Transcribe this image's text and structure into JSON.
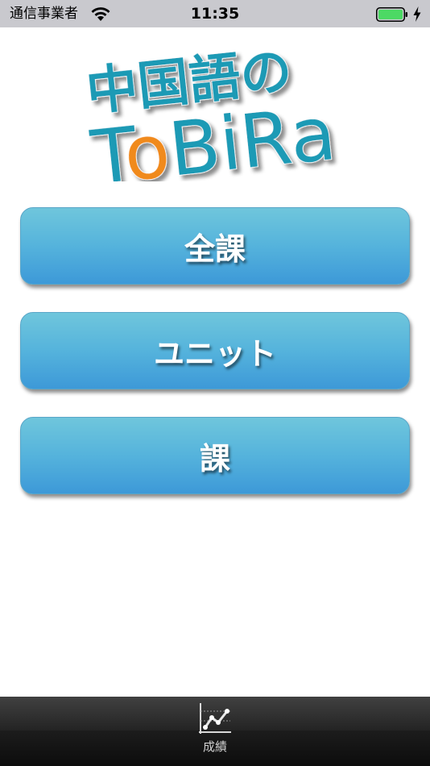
{
  "status_bar": {
    "carrier": "通信事業者",
    "time": "11:35",
    "icons": [
      "wifi-icon",
      "battery-icon",
      "charging-icon"
    ],
    "battery_color": "#4cd964"
  },
  "logo": {
    "line1": "中国語の",
    "line2_part1": "T",
    "line2_o": "o",
    "line2_part2": "BiRa",
    "color_main": "#1a9ab5",
    "color_accent": "#f08a1c"
  },
  "menu": {
    "items": [
      {
        "label": "全課"
      },
      {
        "label": "ユニット"
      },
      {
        "label": "課"
      }
    ],
    "button_gradient": [
      "#6fc6dc",
      "#3d99d8"
    ]
  },
  "tab_bar": {
    "items": [
      {
        "label": "成績",
        "icon": "chart-icon"
      }
    ]
  }
}
